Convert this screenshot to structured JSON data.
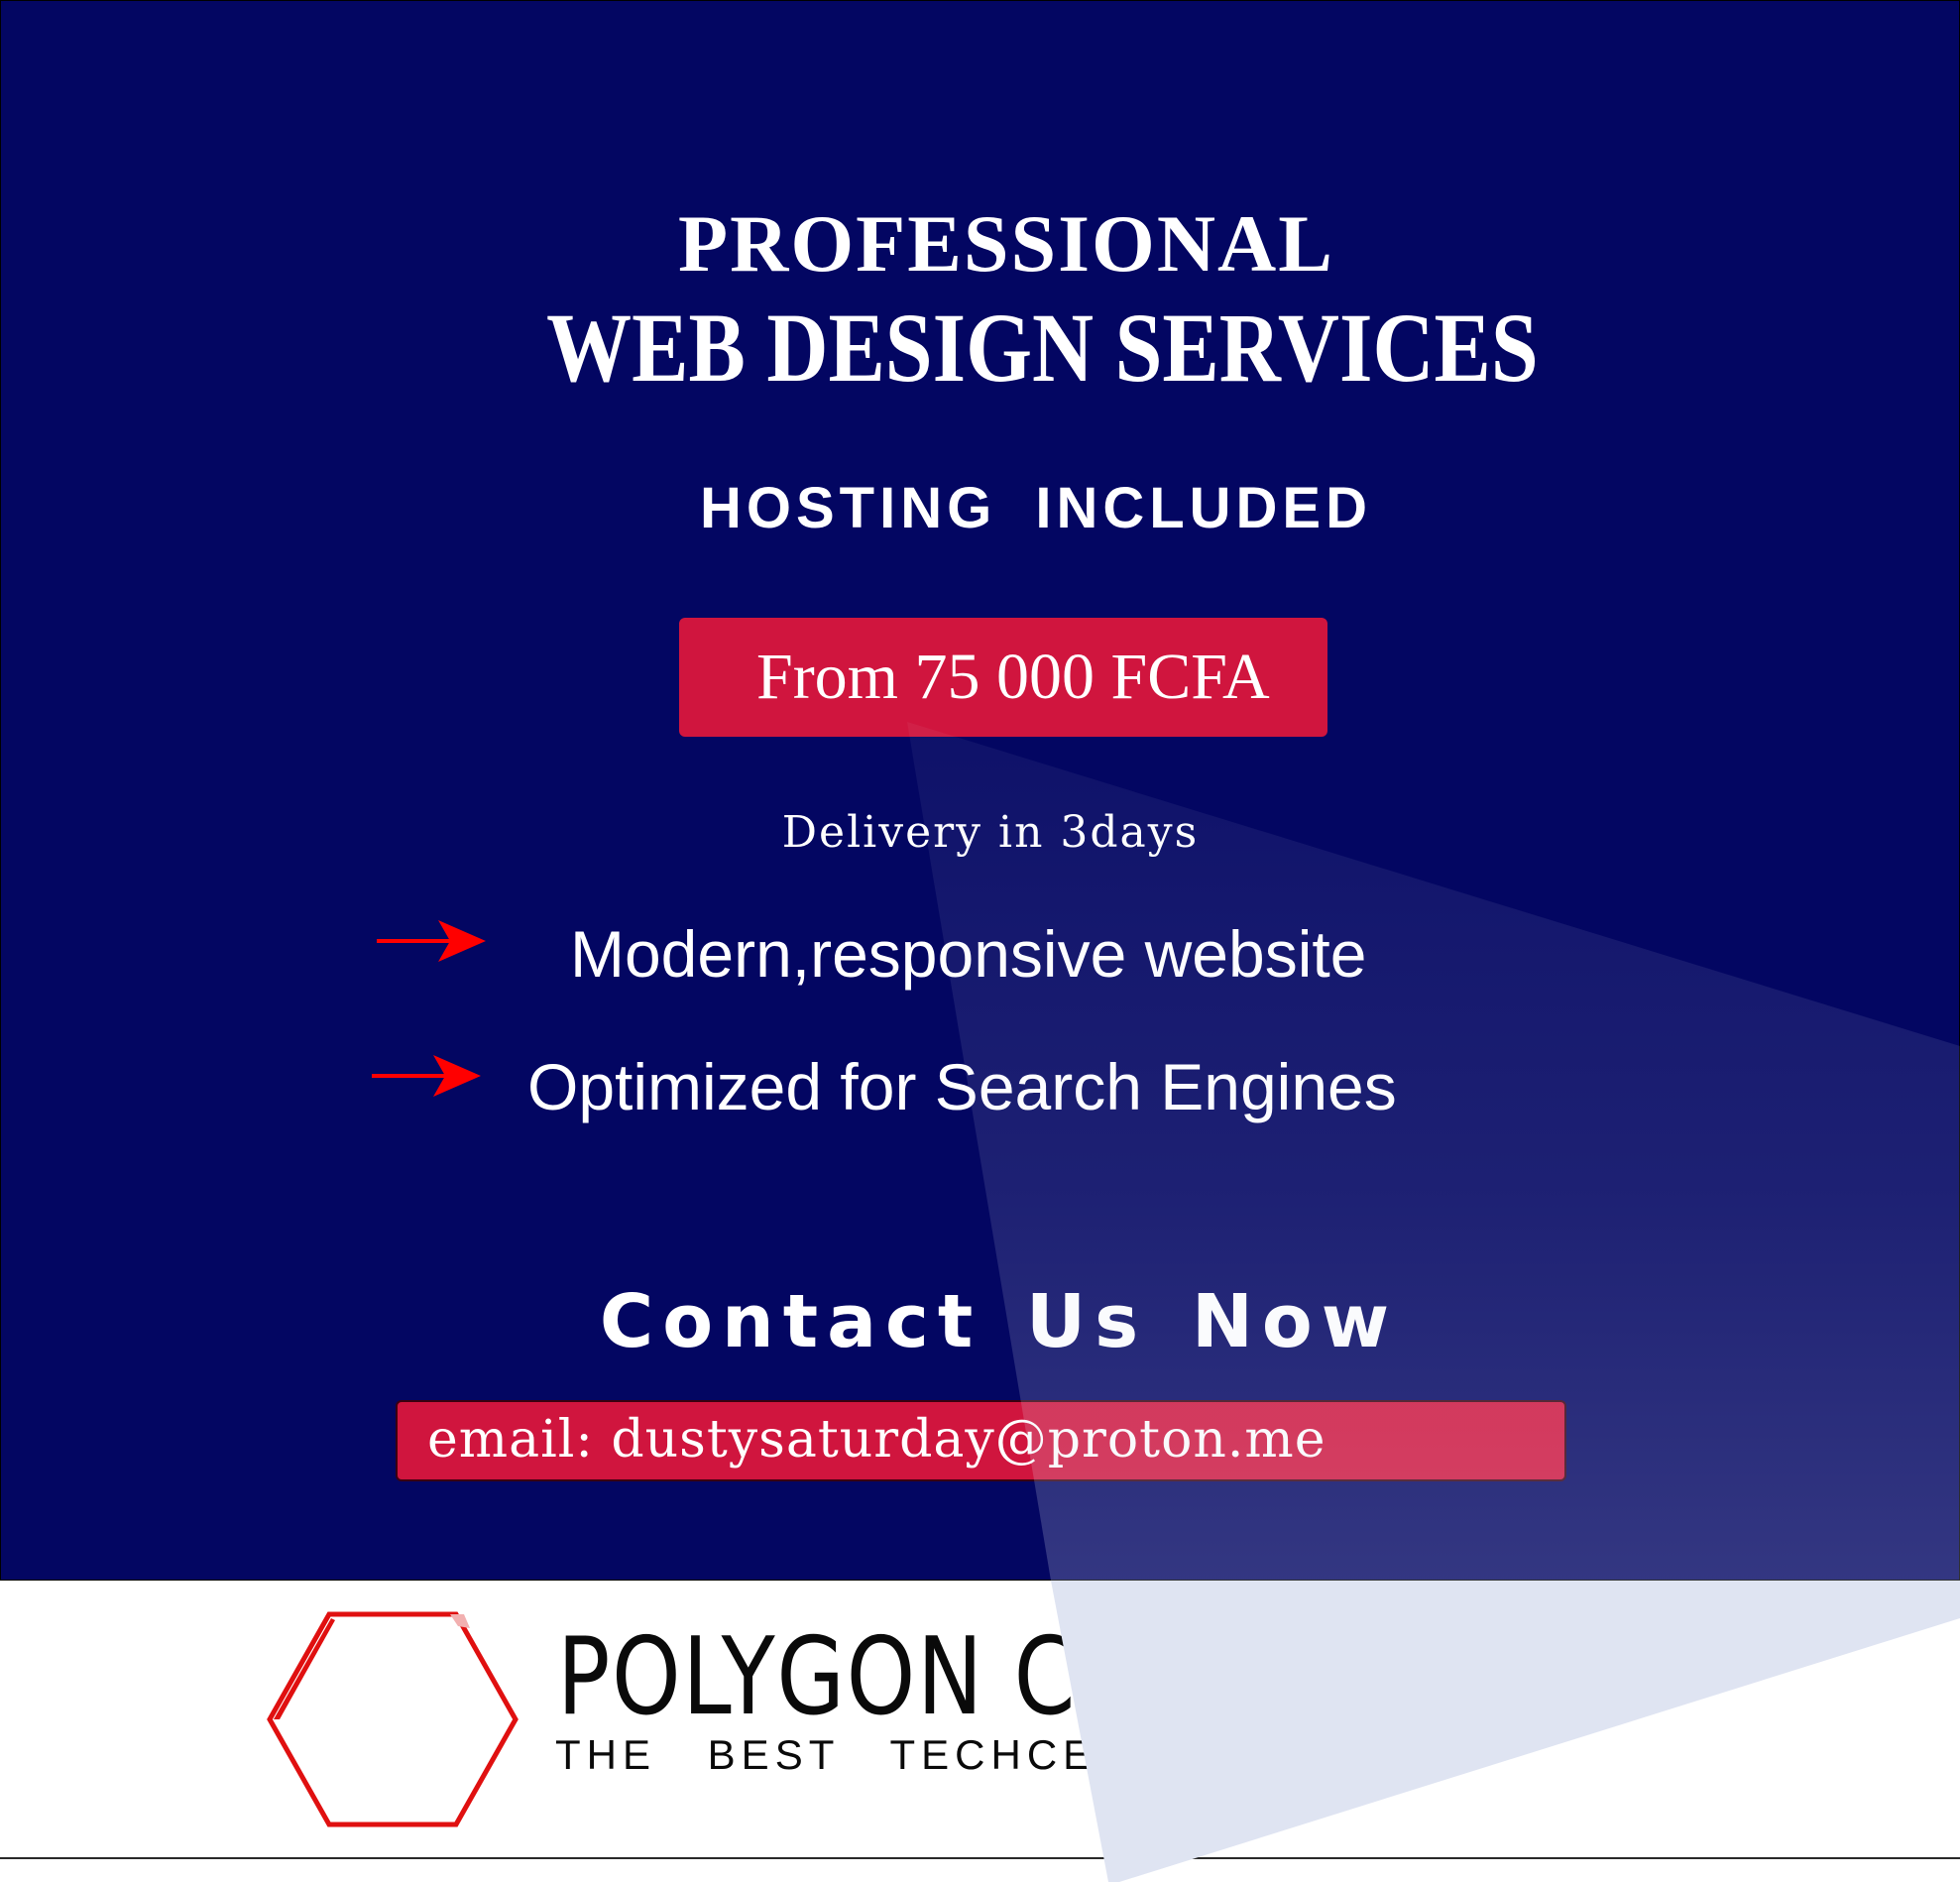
{
  "headline": {
    "line1": "PROFESSIONAL",
    "line2": "WEB DESIGN SERVICES"
  },
  "subhead": "HOSTING  INCLUDED",
  "price": "From 75 000 FCFA",
  "delivery": "Delivery in 3days",
  "features": [
    {
      "text": "Modern,responsive website",
      "icon": "arrow-right-icon"
    },
    {
      "text": "Optimized for Search Engines",
      "icon": "arrow-right-icon"
    }
  ],
  "contact": {
    "heading": "Contact Us Now",
    "email": "email: dustysaturday@proton.me"
  },
  "brand": {
    "logo_icon": "hexagon-icon",
    "name": "POLYGON CORP",
    "tagline": "THE BEST TECHCENTER"
  },
  "colors": {
    "background_blue": "#030662",
    "accent_red": "#d0153e",
    "arrow_red": "#ff0000",
    "text_white": "#ffffff",
    "brand_black": "#0a0a0a",
    "overlay_light": "#dfe4f2"
  }
}
